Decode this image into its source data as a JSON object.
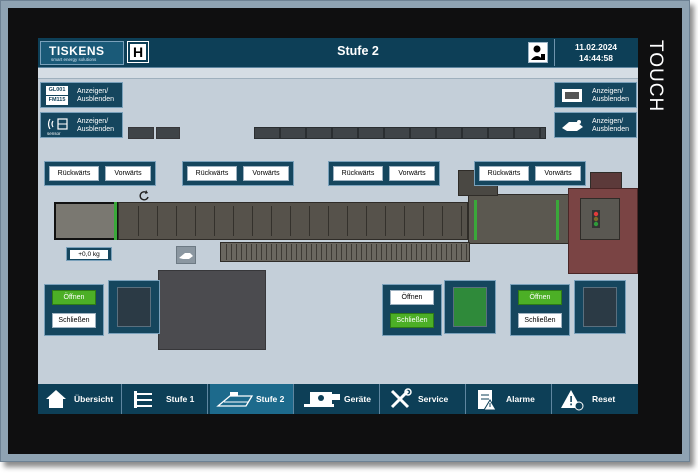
{
  "header": {
    "logo_text": "TISKENS",
    "logo_tagline": "smart energy solutions",
    "h_label": "H",
    "title": "Stufe 2",
    "date": "11.02.2024",
    "time": "14:44:58"
  },
  "side_label": "TOUCH",
  "toggles": {
    "top_left": {
      "code1": "GL001",
      "code2": "FM115",
      "label": "Anzeigen/\nAusblenden"
    },
    "second_left": {
      "device_caption": "sensor",
      "label": "Anzeigen/\nAusblenden"
    },
    "top_right": {
      "label": "Anzeigen/\nAusblenden"
    },
    "second_right": {
      "label": "Anzeigen/\nAusblenden"
    }
  },
  "direction_groups": [
    {
      "back": "Rückwärts",
      "forward": "Vorwärts"
    },
    {
      "back": "Rückwärts",
      "forward": "Vorwärts"
    },
    {
      "back": "Rückwärts",
      "forward": "Vorwärts"
    },
    {
      "back": "Rückwärts",
      "forward": "Vorwärts"
    }
  ],
  "weight_display": "+0,0 kg",
  "doors": [
    {
      "open": "Öffnen",
      "close": "Schließen",
      "active": "open"
    },
    {
      "open": "Öffnen",
      "close": "Schließen",
      "active": "close"
    },
    {
      "open": "Öffnen",
      "close": "Schließen",
      "active": "open"
    }
  ],
  "nav": [
    {
      "label": "Übersicht",
      "icon": "home-icon"
    },
    {
      "label": "Stufe 1",
      "icon": "stage-1-icon"
    },
    {
      "label": "Stufe 2",
      "icon": "stage-2-icon",
      "active": true
    },
    {
      "label": "Geräte",
      "icon": "devices-icon"
    },
    {
      "label": "Service",
      "icon": "tools-icon"
    },
    {
      "label": "Alarme",
      "icon": "alarm-list-icon"
    },
    {
      "label": "Reset",
      "icon": "reset-warning-icon"
    }
  ],
  "colors": {
    "header_bg": "#0d3f57",
    "active_nav": "#1d6a8c",
    "green_button": "#4caf26",
    "screen_bg": "#c4cfd9"
  }
}
